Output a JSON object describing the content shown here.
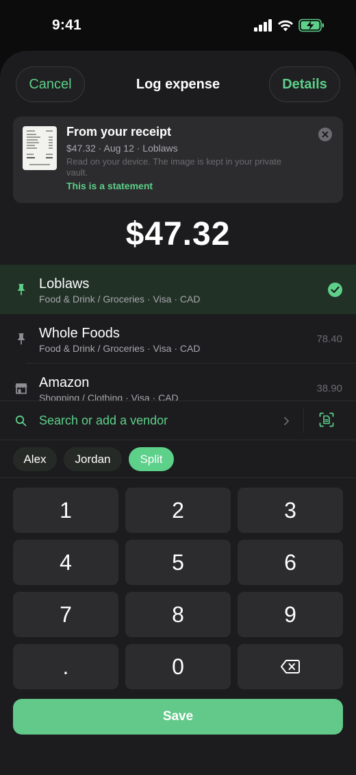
{
  "status_bar": {
    "time": "9:41"
  },
  "header": {
    "cancel_label": "Cancel",
    "title": "Log expense",
    "details_label": "Details"
  },
  "receipt": {
    "title": "From your receipt",
    "meta": "$47.32 · Aug 12 · Loblaws",
    "note": "Read on your device. The image is kept in your private vault.",
    "statement_link": "This is a statement"
  },
  "amount": "$47.32",
  "vendors": [
    {
      "name": "Loblaws",
      "subtitle": "Food & Drink / Groceries · Visa · CAD",
      "amount": "",
      "selected": true,
      "icon": "pin-icon"
    },
    {
      "name": "Whole Foods",
      "subtitle": "Food & Drink / Groceries · Visa · CAD",
      "amount": "78.40",
      "selected": false,
      "icon": "pin-icon"
    },
    {
      "name": "Amazon",
      "subtitle": "Shopping / Clothing · Visa · CAD",
      "amount": "38.90",
      "selected": false,
      "icon": "store-icon"
    }
  ],
  "search": {
    "placeholder": "Search or add a vendor"
  },
  "people": [
    {
      "label": "Alex",
      "active": false
    },
    {
      "label": "Jordan",
      "active": false
    },
    {
      "label": "Split",
      "active": true
    }
  ],
  "keypad": [
    "1",
    "2",
    "3",
    "4",
    "5",
    "6",
    "7",
    "8",
    "9",
    ".",
    "0",
    "⌫"
  ],
  "save_label": "Save",
  "colors": {
    "accent": "#5dd08a",
    "sheet": "#1c1c1e",
    "key": "#2c2c2e",
    "selected_row": "#223126"
  }
}
